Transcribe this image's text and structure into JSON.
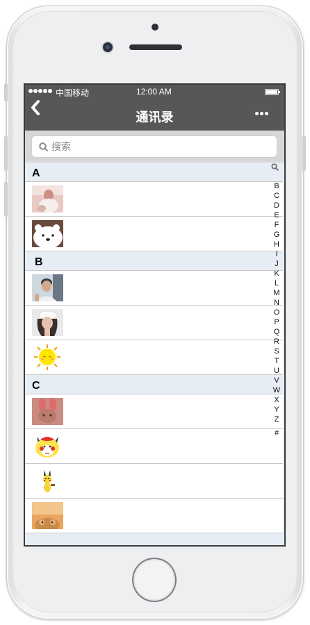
{
  "status_bar": {
    "carrier": "中国移动",
    "time": "12:00 AM"
  },
  "nav": {
    "title": "通讯录"
  },
  "search": {
    "placeholder": "搜索"
  },
  "sections": [
    {
      "letter": "A",
      "contacts": [
        {
          "avatar": "baby-photo",
          "colors": [
            "#e8c9c4",
            "#f2e3df",
            "#c98f83"
          ]
        },
        {
          "avatar": "polar-bear",
          "colors": [
            "#6b4a3e",
            "#ffffff",
            "#2b2b2b"
          ]
        }
      ]
    },
    {
      "letter": "B",
      "contacts": [
        {
          "avatar": "man-photo",
          "colors": [
            "#cfd7df",
            "#3c3c3c",
            "#d2a98c"
          ]
        },
        {
          "avatar": "woman-cap-photo",
          "colors": [
            "#e9e9ea",
            "#3a2f2c",
            "#e6c1b0"
          ]
        },
        {
          "avatar": "sun-cartoon",
          "colors": [
            "#ffffff",
            "#ffe800",
            "#f39c12"
          ]
        }
      ]
    },
    {
      "letter": "C",
      "contacts": [
        {
          "avatar": "bunny-photo",
          "colors": [
            "#c98b82",
            "#e06a6a",
            "#b87b6d"
          ]
        },
        {
          "avatar": "pikachu-cartoon",
          "colors": [
            "#ffffff",
            "#ffe24d",
            "#e0352b"
          ]
        },
        {
          "avatar": "pikachu-small",
          "colors": [
            "#ffffff",
            "#f5d63a",
            "#8a5a2b"
          ]
        },
        {
          "avatar": "plush-photo",
          "colors": [
            "#e9a460",
            "#f3c58a",
            "#c98a4a"
          ]
        }
      ]
    }
  ],
  "index_letters": [
    "B",
    "C",
    "D",
    "E",
    "F",
    "G",
    "H",
    "I",
    "J",
    "K",
    "L",
    "M",
    "N",
    "O",
    "P",
    "Q",
    "R",
    "S",
    "T",
    "U",
    "V",
    "W",
    "X",
    "Y",
    "Z",
    "#"
  ]
}
